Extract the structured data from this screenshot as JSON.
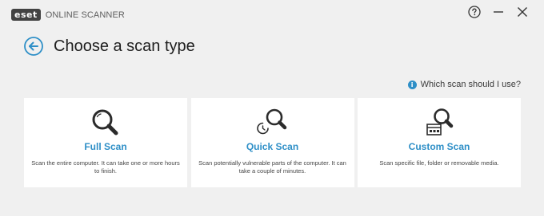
{
  "app": {
    "logo_text": "eset",
    "product_name": "ONLINE SCANNER"
  },
  "window_controls": {
    "help": "help-icon",
    "minimize": "minimize-icon",
    "close": "close-icon"
  },
  "header": {
    "title": "Choose a scan type",
    "back_icon": "arrow-left-circle-icon"
  },
  "help_link": {
    "icon": "info-icon",
    "info_glyph": "i",
    "label": "Which scan should I use?"
  },
  "scan_types": [
    {
      "title": "Full Scan",
      "description": "Scan the entire computer. It can take one or more hours to finish.",
      "icon": "magnifier-icon"
    },
    {
      "title": "Quick Scan",
      "description": "Scan potentially vulnerable parts of the computer. It can take a couple of minutes.",
      "icon": "magnifier-clock-icon"
    },
    {
      "title": "Custom Scan",
      "description": "Scan specific file, folder or removable media.",
      "icon": "magnifier-window-icon"
    }
  ],
  "colors": {
    "accent": "#2e8fc7",
    "background": "#f0f0f0",
    "card": "#ffffff",
    "text": "#1e1e1e"
  }
}
